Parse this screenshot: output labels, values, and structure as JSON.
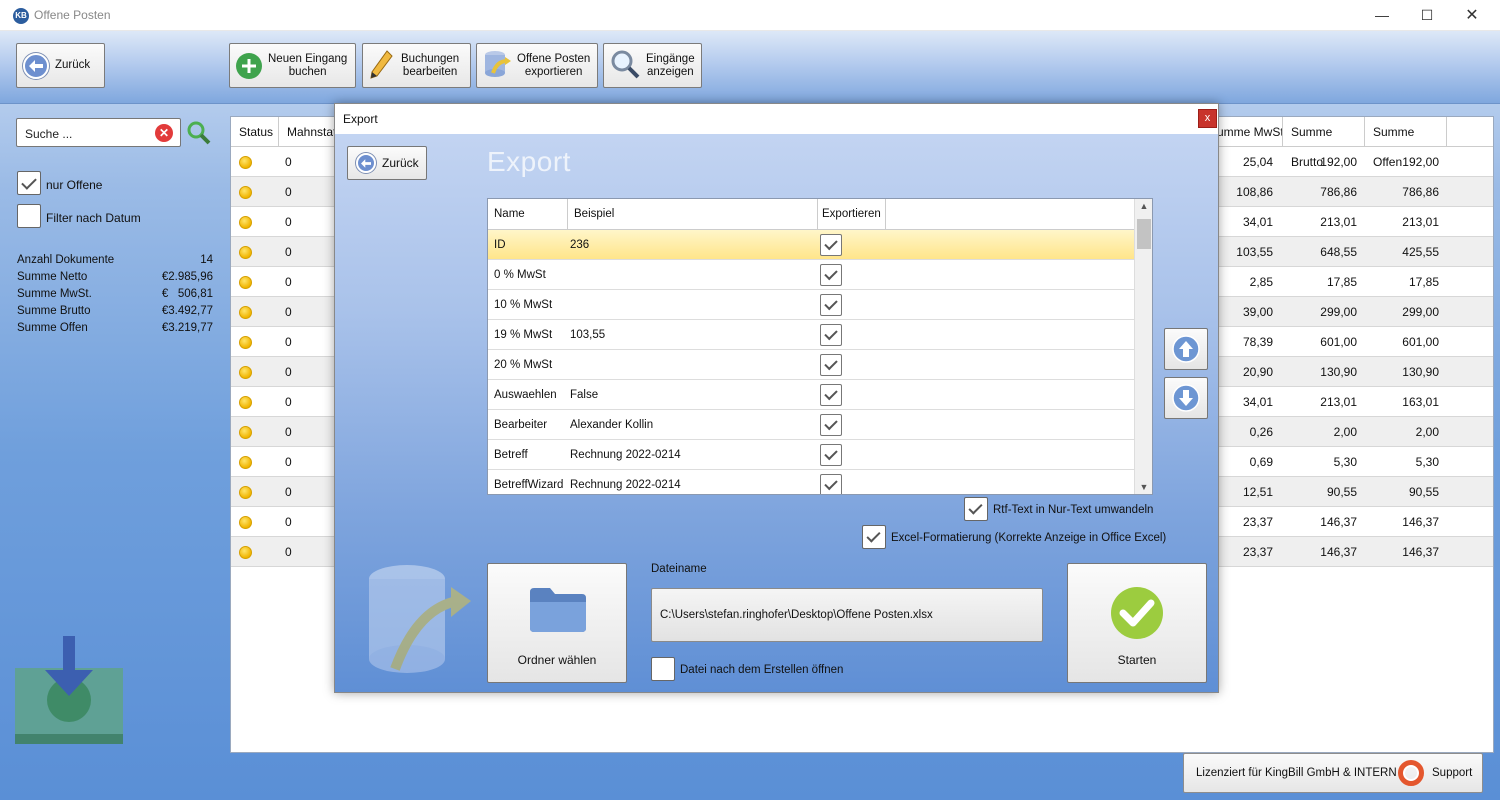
{
  "window": {
    "title": "Offene Posten",
    "app_icon": "KB",
    "minimize": "—",
    "maximize": "☐",
    "close": "✕"
  },
  "toolbar": {
    "back_label": "Zurück",
    "new_entry_label_1": "Neuen Eingang",
    "new_entry_label_2": "buchen",
    "edit_label_1": "Buchungen",
    "edit_label_2": "bearbeiten",
    "export_label_1": "Offene Posten",
    "export_label_2": "exportieren",
    "show_label_1": "Eingänge",
    "show_label_2": "anzeigen"
  },
  "sidebar": {
    "search_placeholder": "Suche ...",
    "only_open_label": "nur Offene",
    "only_open_checked": true,
    "date_filter_label": "Filter nach Datum",
    "date_filter_checked": false,
    "stats": [
      {
        "label": "Anzahl Dokumente",
        "value": "14"
      },
      {
        "label": "Summe Netto",
        "value": "€2.985,96"
      },
      {
        "label": "Summe MwSt.",
        "value": "€   506,81"
      },
      {
        "label": "Summe Brutto",
        "value": "€3.492,77"
      },
      {
        "label": "Summe Offen",
        "value": "€3.219,77"
      }
    ]
  },
  "grid": {
    "headers": {
      "status": "Status",
      "mahnstatus": "Mahnstatu",
      "summe_mwst": "umme MwSt",
      "summe_brutto": "Summe Brutto",
      "summe_offen": "Summe Offen"
    },
    "rows": [
      {
        "mahn": "0",
        "mwst": "25,04",
        "brutto": "192,00",
        "offen": "192,00"
      },
      {
        "mahn": "0",
        "mwst": "108,86",
        "brutto": "786,86",
        "offen": "786,86"
      },
      {
        "mahn": "0",
        "mwst": "34,01",
        "brutto": "213,01",
        "offen": "213,01"
      },
      {
        "mahn": "0",
        "mwst": "103,55",
        "brutto": "648,55",
        "offen": "425,55"
      },
      {
        "mahn": "0",
        "mwst": "2,85",
        "brutto": "17,85",
        "offen": "17,85"
      },
      {
        "mahn": "0",
        "mwst": "39,00",
        "brutto": "299,00",
        "offen": "299,00"
      },
      {
        "mahn": "0",
        "mwst": "78,39",
        "brutto": "601,00",
        "offen": "601,00"
      },
      {
        "mahn": "0",
        "mwst": "20,90",
        "brutto": "130,90",
        "offen": "130,90"
      },
      {
        "mahn": "0",
        "mwst": "34,01",
        "brutto": "213,01",
        "offen": "163,01"
      },
      {
        "mahn": "0",
        "mwst": "0,26",
        "brutto": "2,00",
        "offen": "2,00"
      },
      {
        "mahn": "0",
        "mwst": "0,69",
        "brutto": "5,30",
        "offen": "5,30"
      },
      {
        "mahn": "0",
        "mwst": "12,51",
        "brutto": "90,55",
        "offen": "90,55"
      },
      {
        "mahn": "0",
        "mwst": "23,37",
        "brutto": "146,37",
        "offen": "146,37"
      },
      {
        "mahn": "0",
        "mwst": "23,37",
        "brutto": "146,37",
        "offen": "146,37"
      }
    ]
  },
  "footer": {
    "license": "Lizenziert für KingBill GmbH & INTERN",
    "support": "Support"
  },
  "dialog": {
    "title": "Export",
    "close": "x",
    "back_label": "Zurück",
    "heading": "Export",
    "columns": {
      "name": "Name",
      "example": "Beispiel",
      "export": "Exportieren"
    },
    "fields": [
      {
        "name": "ID",
        "example": "236",
        "export": true,
        "selected": true
      },
      {
        "name": "0 % MwSt",
        "example": "",
        "export": true
      },
      {
        "name": "10 % MwSt",
        "example": "",
        "export": true
      },
      {
        "name": "19 % MwSt",
        "example": "103,55",
        "export": true
      },
      {
        "name": "20 % MwSt",
        "example": "",
        "export": true
      },
      {
        "name": "Auswaehlen",
        "example": "False",
        "export": true
      },
      {
        "name": "Bearbeiter",
        "example": "Alexander Kollin",
        "export": true
      },
      {
        "name": "Betreff",
        "example": "Rechnung 2022-0214",
        "export": true
      },
      {
        "name": "BetreffWizard",
        "example": "Rechnung 2022-0214",
        "export": true
      }
    ],
    "rtf_label": "Rtf-Text in Nur-Text umwandeln",
    "rtf_checked": true,
    "excel_label": "Excel-Formatierung (Korrekte Anzeige in Office Excel)",
    "excel_checked": true,
    "folder_button": "Ordner wählen",
    "filename_label": "Dateiname",
    "filename_value": "C:\\Users\\stefan.ringhofer\\Desktop\\Offene Posten.xlsx",
    "open_after_label": "Datei nach dem Erstellen öffnen",
    "open_after_checked": false,
    "start_button": "Starten"
  }
}
